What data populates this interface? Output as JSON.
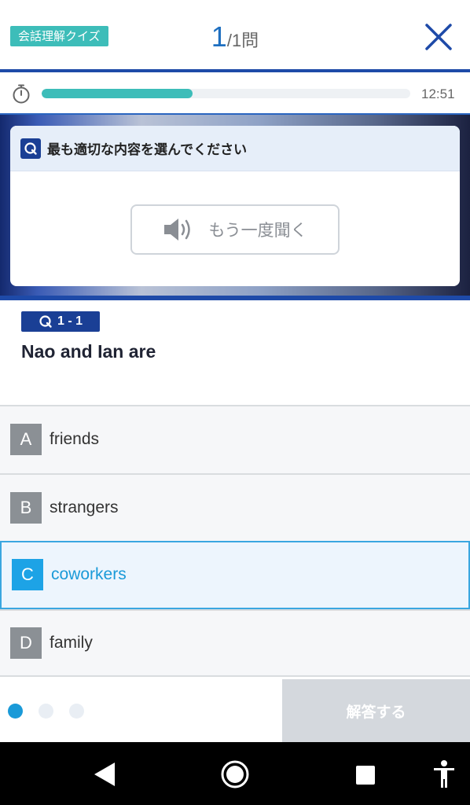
{
  "header": {
    "badge": "会話理解クイズ",
    "counter_current": "1",
    "counter_total": "/1問"
  },
  "timer": {
    "progress": 0.41,
    "time": "12:51"
  },
  "media": {
    "instruction": "最も適切な内容を選んでください",
    "listen_again": "もう一度聞く"
  },
  "question": {
    "number": "1 - 1",
    "text": "Nao and Ian are"
  },
  "options": [
    {
      "letter": "A",
      "label": "friends",
      "selected": false
    },
    {
      "letter": "B",
      "label": "strangers",
      "selected": false
    },
    {
      "letter": "C",
      "label": "coworkers",
      "selected": true
    },
    {
      "letter": "D",
      "label": "family",
      "selected": false
    }
  ],
  "footer": {
    "page_dots": 3,
    "active_dot": 0,
    "submit_label": "解答する"
  },
  "colors": {
    "accent_teal": "#3dbdb9",
    "brand_blue": "#1e4aa8",
    "selected_blue": "#1da3e6",
    "disabled_gray": "#d4d8dd"
  },
  "icons": [
    "close-icon",
    "stopwatch-icon",
    "question-icon",
    "speaker-icon",
    "back-icon",
    "home-icon",
    "recents-icon",
    "accessibility-icon"
  ]
}
